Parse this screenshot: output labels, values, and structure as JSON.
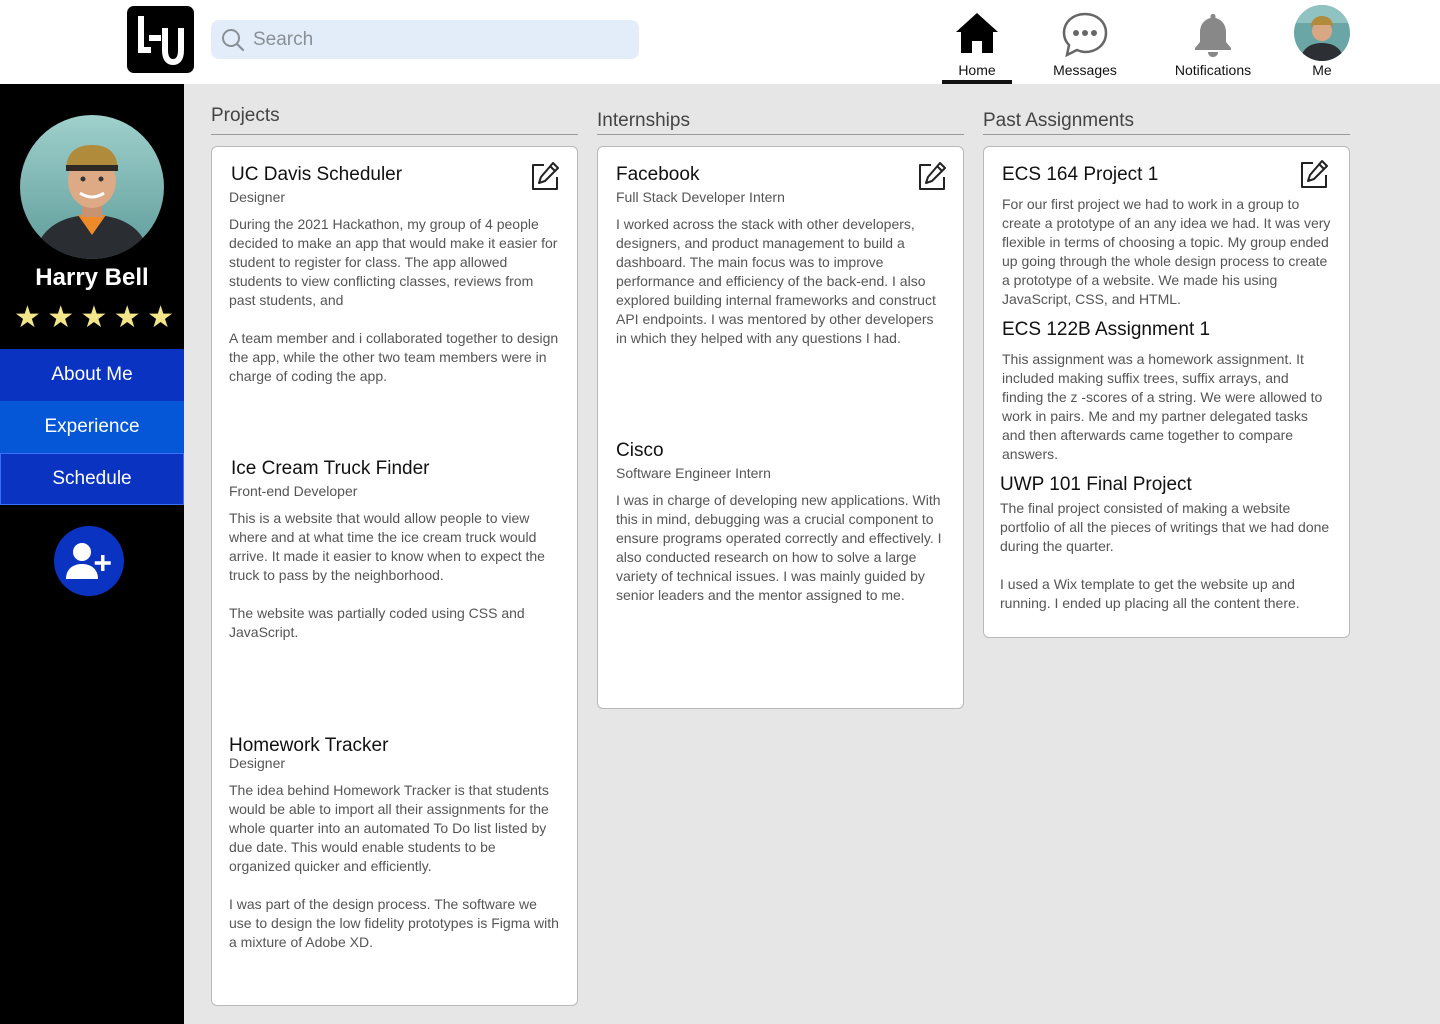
{
  "header": {
    "logo_text": "LU",
    "search_placeholder": "Search",
    "nav": {
      "home": "Home",
      "messages": "Messages",
      "notifications": "Notifications",
      "me": "Me"
    },
    "active_nav": "home"
  },
  "sidebar": {
    "name": "Harry Bell",
    "rating": 5,
    "stars": "★★★★★",
    "buttons": {
      "about": "About Me",
      "experience": "Experience",
      "schedule": "Schedule"
    },
    "add_icon": "user-plus-icon"
  },
  "colors": {
    "sidebar_bg": "#000000",
    "primary_blue": "#0a33c2",
    "secondary_blue": "#0557d8",
    "search_bg": "#e3edf9",
    "star": "#f3e68a",
    "page_bg": "#e6e6e6"
  },
  "projects": {
    "title": "Projects",
    "items": [
      {
        "title": "UC Davis Scheduler",
        "role": "Designer",
        "paragraphs": [
          "During the 2021 Hackathon, my group of 4 people decided to make an app that would make it easier for student to register for class. The app allowed students to view conflicting classes, reviews from past students, and",
          "A team member and i collaborated together to design the app, while the other two team members were in charge of coding the app."
        ]
      },
      {
        "title": "Ice Cream Truck Finder",
        "role": "Front-end Developer",
        "paragraphs": [
          "This is a website that would allow people to view where and at what time the ice cream truck would arrive. It made it easier to know when to expect the truck to pass by the neighborhood.",
          "The website was partially coded using CSS and JavaScript."
        ]
      },
      {
        "title": "Homework Tracker",
        "role": "Designer",
        "paragraphs": [
          "The idea behind Homework Tracker is that students would be able to import all their assignments for the whole quarter into an automated To Do list listed by due date. This would enable students to be organized quicker and efficiently.",
          "I was part of the design process. The software we use to design the low fidelity prototypes is Figma with a mixture of Adobe XD."
        ]
      }
    ]
  },
  "internships": {
    "title": "Internships",
    "items": [
      {
        "title": "Facebook",
        "role": "Full Stack Developer Intern",
        "paragraphs": [
          "I worked across the stack with other developers, designers, and product management to build a dashboard. The main focus was to improve performance and efficiency of the back-end. I also explored building internal frameworks and construct API endpoints. I was mentored by other developers in which they helped with any questions I had."
        ]
      },
      {
        "title": "Cisco",
        "role": "Software Engineer Intern",
        "paragraphs": [
          "I was in charge of developing new applications. With this in mind, debugging was a crucial component to ensure programs operated correctly and effectively. I also conducted research on how to solve a large variety of technical issues. I was mainly guided by senior leaders and the mentor assigned to me."
        ]
      }
    ]
  },
  "past_assignments": {
    "title": "Past Assignments",
    "items": [
      {
        "title": "ECS 164 Project 1",
        "paragraphs": [
          "For our first project we had to work in a group to create a prototype of an any idea we had. It was very flexible in terms of choosing a topic. My group ended up going through the whole design process to create a prototype of a website. We made his using JavaScript, CSS, and HTML."
        ]
      },
      {
        "title": "ECS 122B Assignment 1",
        "paragraphs": [
          "This assignment was a homework assignment. It included making suffix trees, suffix arrays, and finding the z -scores of a string. We were allowed to work in pairs. Me and my partner delegated tasks and then afterwards came together to compare answers."
        ]
      },
      {
        "title": "UWP 101 Final Project",
        "paragraphs": [
          "The final project consisted of making a website portfolio of all the pieces of writings that we had done during the quarter.",
          "I used a Wix template to get the website up and running. I ended up placing all the content there."
        ]
      }
    ]
  }
}
